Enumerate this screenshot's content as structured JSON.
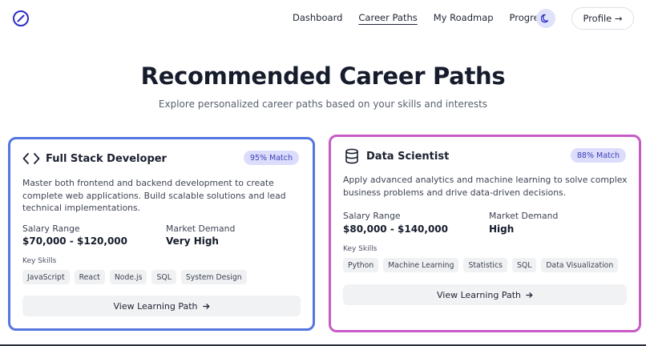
{
  "nav": {
    "logo_icon": "compass-icon",
    "links": [
      {
        "label": "Dashboard"
      },
      {
        "label": "Career Paths"
      },
      {
        "label": "My Roadmap"
      },
      {
        "label": "Progress"
      }
    ],
    "active_link": "Career Paths",
    "theme_icon": "moon-icon",
    "profile_label": "Profile →"
  },
  "hero": {
    "title": "Recommended Career Paths",
    "subtitle": "Explore personalized career paths based on your skills and interests"
  },
  "cards": [
    {
      "icon": "code-brackets-icon",
      "title": "Full Stack Developer",
      "match": "95% Match",
      "description": "Master both frontend and backend development to create complete web applications. Build scalable solutions and lead technical implementations.",
      "salary_label": "Salary Range",
      "salary_value": "$70,000 - $120,000",
      "demand_label": "Market Demand",
      "demand_value": "Very High",
      "skills_label": "Key Skills",
      "skills": [
        "JavaScript",
        "React",
        "Node.js",
        "SQL",
        "System Design"
      ],
      "cta": "View Learning Path",
      "border_color": "#5576e0"
    },
    {
      "icon": "database-icon",
      "title": "Data Scientist",
      "match": "88% Match",
      "description": "Apply advanced analytics and machine learning to solve complex business problems and drive data-driven decisions.",
      "salary_label": "Salary Range",
      "salary_value": "$80,000 - $140,000",
      "demand_label": "Market Demand",
      "demand_value": "High",
      "skills_label": "Key Skills",
      "skills": [
        "Python",
        "Machine Learning",
        "Statistics",
        "SQL",
        "Data Visualization"
      ],
      "cta": "View Learning Path",
      "border_color": "#c65bc5"
    }
  ],
  "colors": {
    "accent": "#3b3fb8",
    "badge_bg": "#dcdcfc",
    "chip_bg": "#f0f1f3"
  }
}
